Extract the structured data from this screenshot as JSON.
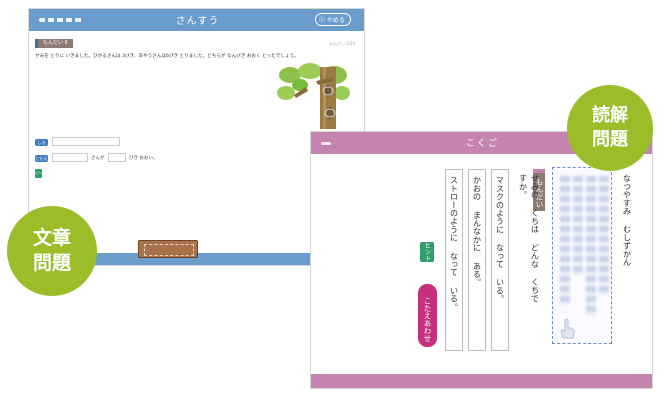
{
  "math_screen": {
    "title": "さんすう",
    "quit_label": "ⓧ やめる",
    "question_label": "もんだい 6",
    "question_text": "せみを とりに いきました。ひかるさんは 3びき、あやうさんは6ぴき とりました。どちらが なんびき おおく とったでしょう。",
    "side_tiny": "もんだい 6/10",
    "shiki_tag": "しき",
    "kotae_tag": "こたえ",
    "answer_mid": "さんが",
    "answer_end": "びき おおい。",
    "hint_small": "ヒント"
  },
  "jp_screen": {
    "title": "こくご",
    "question_label": "もんだい 1",
    "question_text": "せみの くちは どんな くちですか。",
    "reading_text": "なつやすみ むしずかん",
    "options": [
      "マスクのように なって いる。",
      "かおの まんなかに ある。",
      "ストローのように なって いる。"
    ],
    "hint_label": "ヒント",
    "answer_check_label": "こたえあわせ"
  },
  "labels": {
    "word_problems": [
      "文章",
      "問題"
    ],
    "reading_problems": [
      "読解",
      "問題"
    ]
  },
  "colors": {
    "math_accent": "#6a9ccc",
    "jp_accent": "#c584ad",
    "circle_green": "#9cbd2a",
    "hint_green": "#2e9e6a",
    "answer_magenta": "#c72e7d"
  }
}
